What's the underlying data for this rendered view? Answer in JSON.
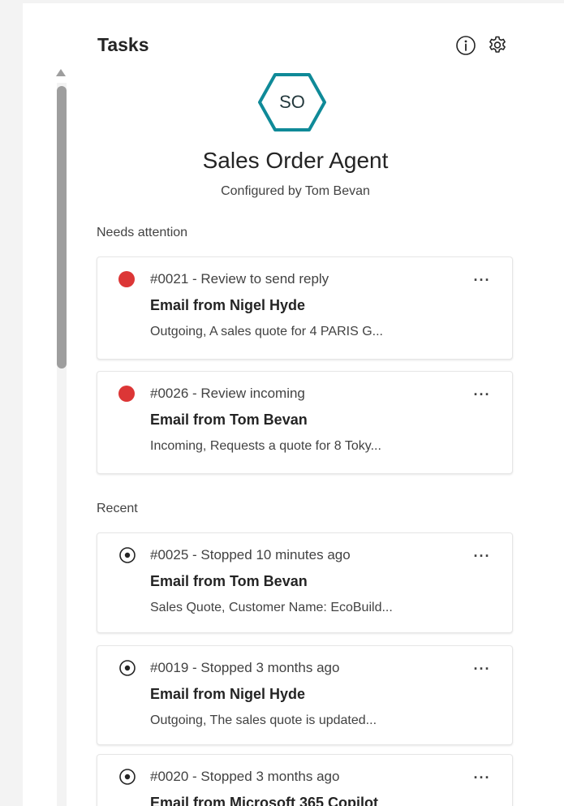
{
  "header": {
    "title": "Tasks",
    "info_icon": "info-icon",
    "settings_icon": "gear-icon"
  },
  "agent": {
    "initials": "SO",
    "name": "Sales Order Agent",
    "configured_by": "Configured by Tom Bevan",
    "accent_color": "#0f8a98"
  },
  "sections": {
    "needs_attention": "Needs attention",
    "recent": "Recent"
  },
  "needs_attention_tasks": [
    {
      "status": "needs-attention",
      "title": "#0021 - Review to send reply",
      "subject": "Email from Nigel Hyde",
      "summary": "Outgoing, A sales quote for 4 PARIS G..."
    },
    {
      "status": "needs-attention",
      "title": "#0026 - Review incoming",
      "subject": "Email from Tom Bevan",
      "summary": "Incoming, Requests a quote for 8 Toky..."
    }
  ],
  "recent_tasks": [
    {
      "status": "stopped",
      "title": "#0025 - Stopped 10 minutes ago",
      "subject": "Email from Tom Bevan",
      "summary": "Sales Quote, Customer Name: EcoBuild..."
    },
    {
      "status": "stopped",
      "title": "#0019 - Stopped 3 months ago",
      "subject": "Email from Nigel Hyde",
      "summary": "Outgoing, The sales quote is updated..."
    },
    {
      "status": "stopped",
      "title": "#0020 - Stopped 3 months ago",
      "subject": "Email from Microsoft 365 Copilot",
      "summary": ""
    }
  ],
  "more_button_label": "···",
  "colors": {
    "attention": "#dc3636",
    "page_background": "#f3f3f3",
    "panel_background": "#ffffff"
  }
}
